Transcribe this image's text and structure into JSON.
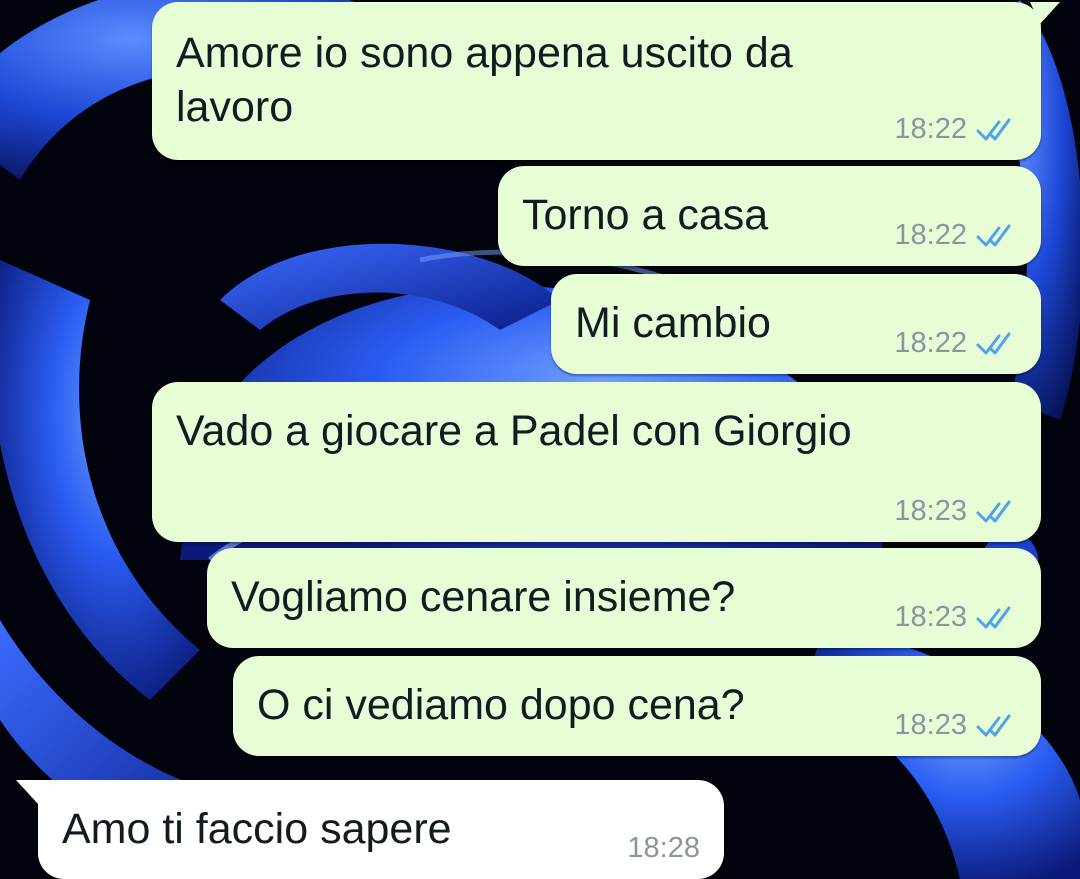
{
  "messages": [
    {
      "direction": "out",
      "text": "Amore io sono appena uscito da\nlavoro",
      "time": "18:22",
      "status": "read-double-tick-icon"
    },
    {
      "direction": "out",
      "text": "Torno a casa",
      "time": "18:22",
      "status": "read-double-tick-icon"
    },
    {
      "direction": "out",
      "text": "Mi cambio",
      "time": "18:22",
      "status": "read-double-tick-icon"
    },
    {
      "direction": "out",
      "text": "Vado a giocare a Padel con Giorgio",
      "time": "18:23",
      "status": "read-double-tick-icon"
    },
    {
      "direction": "out",
      "text": "Vogliamo cenare insieme?",
      "time": "18:23",
      "status": "read-double-tick-icon"
    },
    {
      "direction": "out",
      "text": "O ci vediamo dopo cena?",
      "time": "18:23",
      "status": "read-double-tick-icon"
    },
    {
      "direction": "in",
      "text": "Amo ti faccio sapere",
      "time": "18:28"
    }
  ],
  "colors": {
    "outgoing_bubble": "#e7fdd6",
    "incoming_bubble": "#ffffff",
    "read_tick": "#4fa3e8",
    "time_text": "#8a969e",
    "message_text": "#111b21",
    "wallpaper_dark": "#02040d",
    "wallpaper_blue": "#2a5cf2"
  }
}
